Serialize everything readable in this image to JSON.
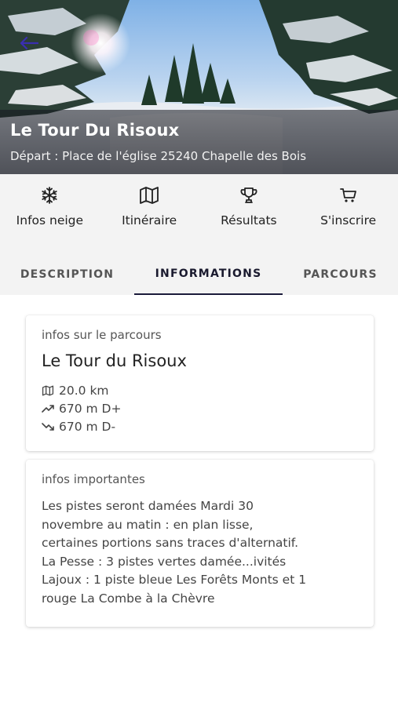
{
  "header": {
    "title": "Le Tour Du Risoux",
    "subtitle": "Départ : Place de l'église 25240 Chapelle des Bois"
  },
  "actions": [
    {
      "label": "Infos neige",
      "icon": "snowflake-icon"
    },
    {
      "label": "Itinéraire",
      "icon": "map-icon"
    },
    {
      "label": "Résultats",
      "icon": "trophy-icon"
    },
    {
      "label": "S'inscrire",
      "icon": "cart-icon"
    }
  ],
  "tabs": [
    {
      "label": "DESCRIPTION",
      "active": false
    },
    {
      "label": "INFORMATIONS",
      "active": true
    },
    {
      "label": "PARCOURS",
      "active": false
    }
  ],
  "course_card": {
    "caption": "infos sur le parcours",
    "name": "Le Tour du Risoux",
    "distance": "20.0 km",
    "elevation_gain": "670 m D+",
    "elevation_loss": "670 m D-"
  },
  "important_card": {
    "caption": "infos importantes",
    "lines": [
      "Les pistes seront damées Mardi 30",
      "novembre au matin : en plan lisse,",
      "certaines portions sans traces d'alternatif.",
      "La Pesse : 3 pistes vertes damée...ivités",
      "Lajoux : 1 piste bleue Les Forêts Monts et 1",
      "rouge La Combe à la Chèvre"
    ]
  },
  "colors": {
    "accent": "#1a1a3a",
    "bar_background": "#f3f3f3"
  }
}
